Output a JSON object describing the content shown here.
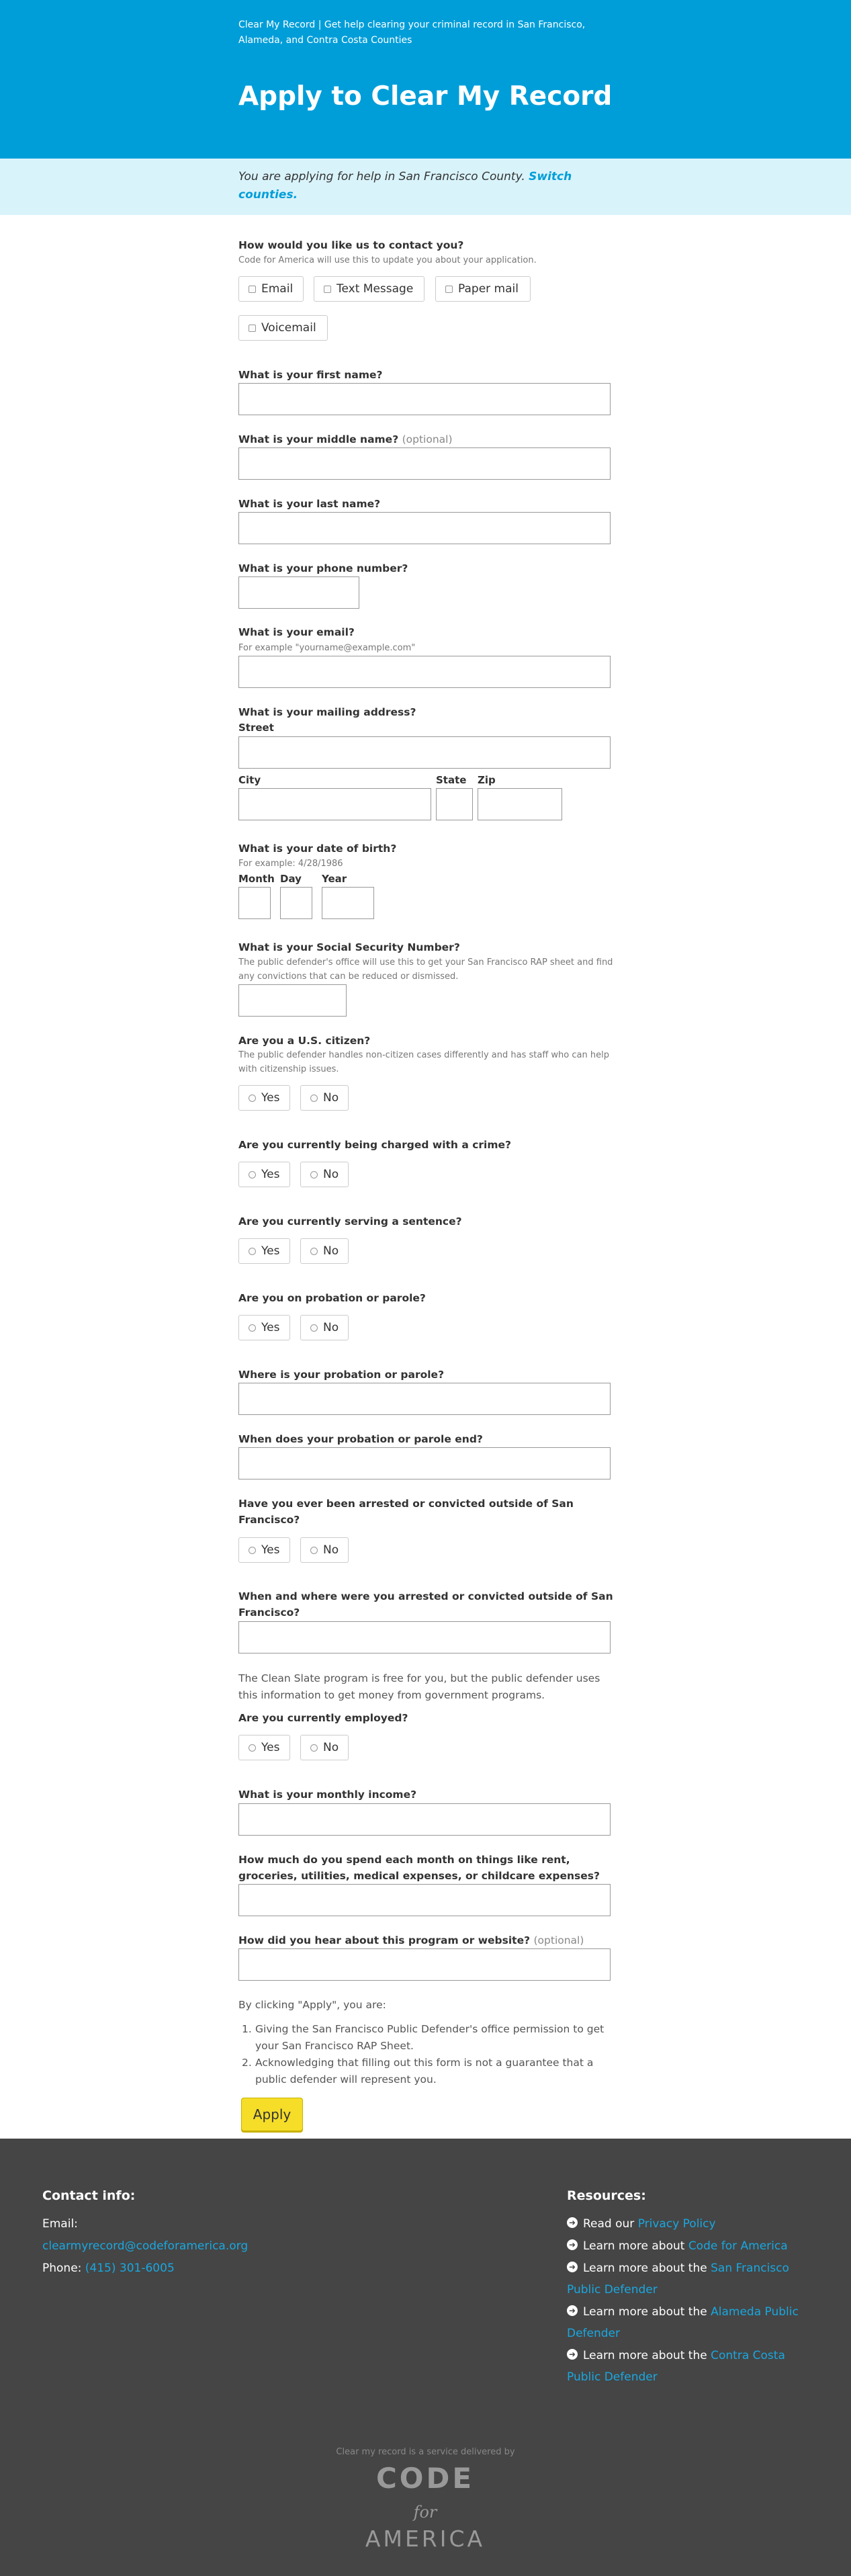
{
  "header": {
    "tagline": "Clear My Record | Get help clearing your criminal record in San Francisco, Alameda, and Contra Costa Counties",
    "title": "Apply to Clear My Record"
  },
  "county": {
    "text": "You are applying for help in San Francisco County.",
    "switch_link": "Switch counties."
  },
  "contact": {
    "question": "How would you like us to contact you?",
    "hint": "Code for America will use this to update you about your application.",
    "options": [
      "Email",
      "Text Message",
      "Paper mail",
      "Voicemail"
    ]
  },
  "first_name": {
    "label": "What is your first name?"
  },
  "middle_name": {
    "label": "What is your middle name?",
    "optional": "(optional)"
  },
  "last_name": {
    "label": "What is your last name?"
  },
  "phone": {
    "label": "What is your phone number?"
  },
  "email": {
    "label": "What is your email?",
    "hint": "For example \"yourname@example.com\""
  },
  "address": {
    "label": "What is your mailing address?",
    "street": "Street",
    "city": "City",
    "state": "State",
    "zip": "Zip"
  },
  "dob": {
    "label": "What is your date of birth?",
    "hint": "For example: 4/28/1986",
    "month": "Month",
    "day": "Day",
    "year": "Year"
  },
  "ssn": {
    "label": "What is your Social Security Number?",
    "hint": "The public defender's office will use this to get your San Francisco RAP sheet and find any convictions that can be reduced or dismissed."
  },
  "citizen": {
    "label": "Are you a U.S. citizen?",
    "hint": "The public defender handles non-citizen cases differently and has staff who can help with citizenship issues."
  },
  "charged": {
    "label": "Are you currently being charged with a crime?"
  },
  "sentence": {
    "label": "Are you currently serving a sentence?"
  },
  "probation": {
    "label": "Are you on probation or parole?"
  },
  "probation_where": {
    "label": "Where is your probation or parole?"
  },
  "probation_end": {
    "label": "When does your probation or parole end?"
  },
  "outside": {
    "label": "Have you ever been arrested or convicted outside of San Francisco?"
  },
  "outside_when": {
    "label": "When and where were you arrested or convicted outside of San Francisco?"
  },
  "clean_slate_note": "The Clean Slate program is free for you, but the public defender uses this information to get money from government programs.",
  "employed": {
    "label": "Are you currently employed?"
  },
  "income": {
    "label": "What is your monthly income?"
  },
  "expenses": {
    "label": "How much do you spend each month on things like rent, groceries, utilities, medical expenses, or childcare expenses?"
  },
  "heard": {
    "label": "How did you hear about this program or website?",
    "optional": "(optional)"
  },
  "yes_no": {
    "yes": "Yes",
    "no": "No"
  },
  "consent": {
    "intro": "By clicking \"Apply\", you are:",
    "items": [
      {
        "num": "1.",
        "text": "Giving the San Francisco Public Defender's office permission to get your San Francisco RAP Sheet."
      },
      {
        "num": "2.",
        "text": "Acknowledging that filling out this form is not a guarantee that a public defender will represent you."
      }
    ]
  },
  "apply_label": "Apply",
  "footer": {
    "contact_heading": "Contact info:",
    "email_label": "Email:",
    "email_value": "clearmyrecord@codeforamerica.org",
    "phone_label": "Phone:",
    "phone_value": "(415) 301-6005",
    "resources_heading": "Resources:",
    "resources": [
      {
        "prefix": "Read our ",
        "link": "Privacy Policy"
      },
      {
        "prefix": "Learn more about ",
        "link": "Code for America"
      },
      {
        "prefix": "Learn more about the ",
        "link": "San Francisco Public Defender"
      },
      {
        "prefix": "Learn more about the ",
        "link": "Alameda Public Defender"
      },
      {
        "prefix": "Learn more about the ",
        "link": "Contra Costa Public Defender"
      }
    ],
    "delivered": "Clear my record is a service delivered by",
    "logo_code": "CODE",
    "logo_for": "for",
    "logo_america": "AMERICA"
  },
  "colors": {
    "header_bg": "#009ed9",
    "county_bg": "#d9f3fb",
    "link": "#009ed9",
    "apply_bg": "#f5dd28",
    "footer_bg": "#454545",
    "footer_link": "#19a7e0"
  }
}
